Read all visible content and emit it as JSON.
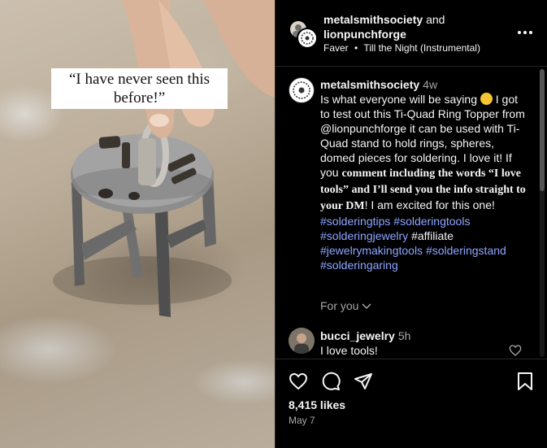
{
  "media": {
    "quote_line1": "“I have never seen this",
    "quote_line2": "before!”"
  },
  "header": {
    "user1": "metalsmithsociety",
    "and_text": "and",
    "user2": "lionpunchforge",
    "audio_artist": "Faver",
    "separator": "•",
    "audio_track": "Till the Night (Instrumental)",
    "more_icon": "more-horizontal-icon"
  },
  "caption": {
    "username": "metalsmithsociety",
    "time": "4w",
    "text_1": "Is what everyone will be saying ",
    "emoji": "rolling-laughing-emoji",
    "text_2": " I got to test out this Ti-Quad Ring Topper from @lionpunchforge it can be used with Ti-Quad stand to hold rings, spheres, domed pieces for soldering. I love it! If you ",
    "serif_bold": "comment including the words “I love tools” and I’ll send you the info straight to your DM",
    "text_3": "! I am excited for this one!",
    "tag1": "#solderingtips",
    "tag2": "#solderingtools",
    "tag3": "#solderingjewelry",
    "plain_tag": "#affiliate",
    "tag4": "#jewelrymakingtools",
    "tag5": "#solderingstand",
    "tag6": "#solderingaring"
  },
  "for_you": "For you",
  "comment": {
    "username": "bucci_jewelry",
    "time": "5h",
    "text": "I love tools!"
  },
  "actions": {
    "likes": "8,415 likes",
    "date": "May 7"
  },
  "colors": {
    "hashtag": "#8ea5ff",
    "muted": "#a8a8a8",
    "background": "#000000"
  }
}
